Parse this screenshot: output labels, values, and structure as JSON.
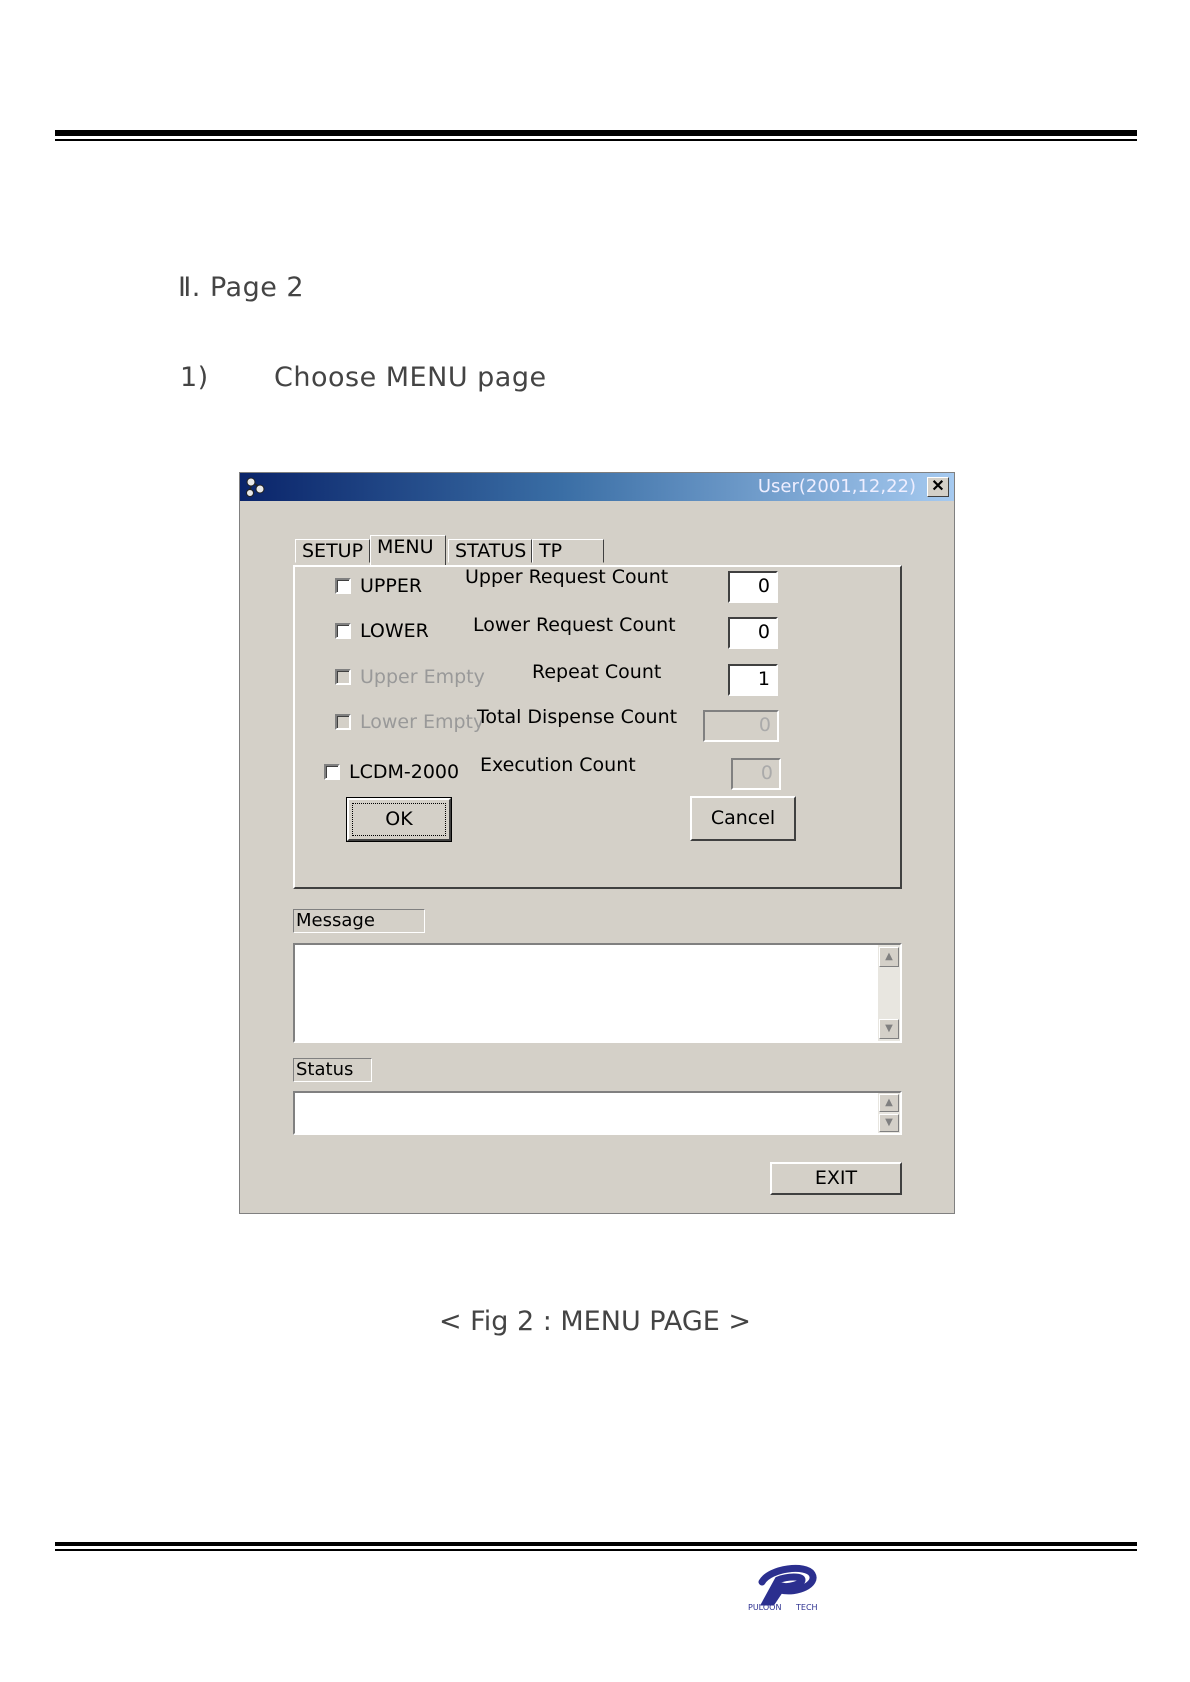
{
  "headings": {
    "section": "Ⅱ.  Page 2",
    "step_number": "1)",
    "step_text": "Choose MENU page"
  },
  "dialog": {
    "title": "User(2001,12,22)",
    "close_label": "✕",
    "tabs": [
      {
        "label": "SETUP",
        "active": false
      },
      {
        "label": "MENU",
        "active": true
      },
      {
        "label": "STATUS",
        "active": false
      },
      {
        "label": "TP",
        "active": false
      }
    ],
    "checkboxes": [
      {
        "label": "UPPER",
        "checked": false,
        "enabled": true
      },
      {
        "label": "LOWER",
        "checked": false,
        "enabled": true
      },
      {
        "label": "Upper Empty",
        "checked": false,
        "enabled": false
      },
      {
        "label": "Lower Empty",
        "checked": false,
        "enabled": false
      },
      {
        "label": "LCDM-2000",
        "checked": false,
        "enabled": true
      }
    ],
    "fields": [
      {
        "label": "Upper Request Count",
        "value": "0",
        "enabled": true
      },
      {
        "label": "Lower Request Count",
        "value": "0",
        "enabled": true
      },
      {
        "label": "Repeat Count",
        "value": "1",
        "enabled": true
      },
      {
        "label": "Total Dispense Count",
        "value": "0",
        "enabled": false
      },
      {
        "label": "Execution Count",
        "value": "0",
        "enabled": false
      }
    ],
    "ok_label": "OK",
    "cancel_label": "Cancel",
    "message_label": "Message",
    "status_label": "Status",
    "exit_label": "EXIT"
  },
  "caption": "< Fig 2 : MENU PAGE >",
  "logo": {
    "left_text": "PULOON",
    "right_text": "TECH",
    "color": "#2b2f8f"
  }
}
